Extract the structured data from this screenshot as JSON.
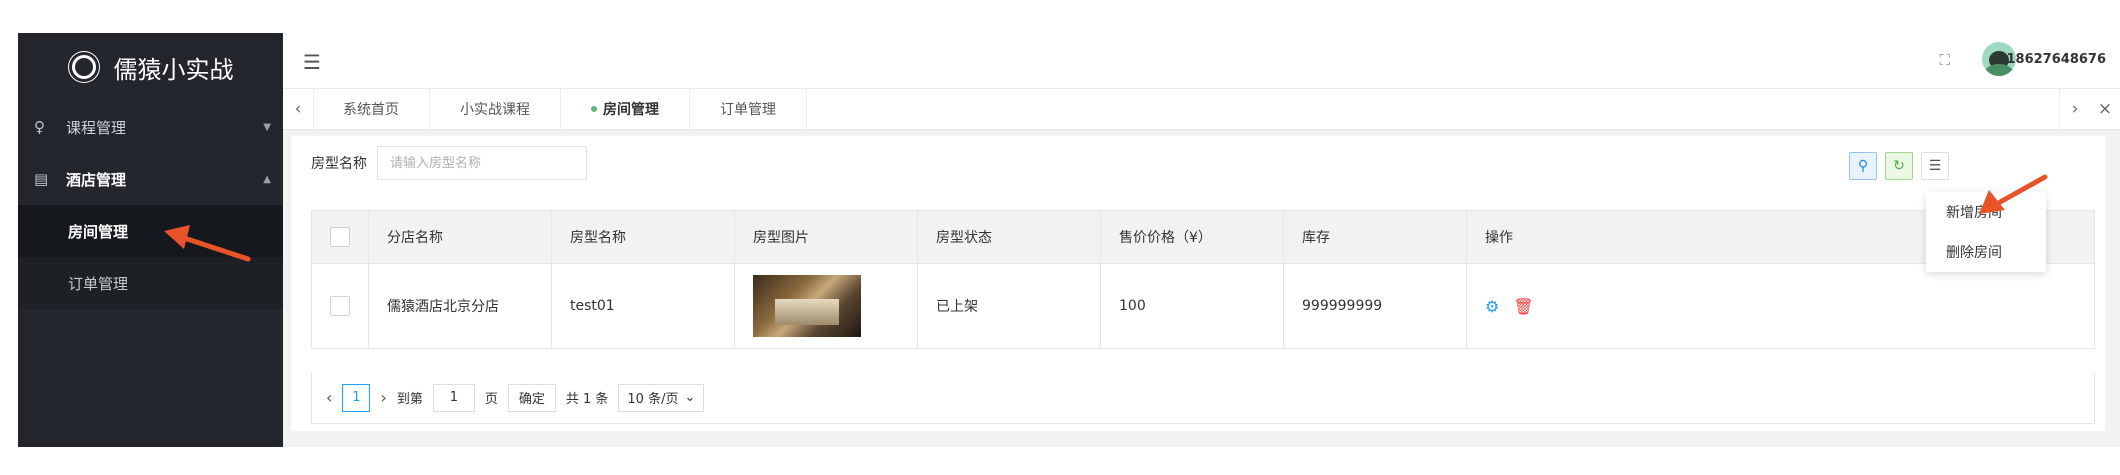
{
  "app": {
    "title": "儒猿小实战"
  },
  "sidebar": {
    "groups": [
      {
        "label": "课程管理",
        "icon": "user-icon",
        "open": false
      },
      {
        "label": "酒店管理",
        "icon": "building-icon",
        "open": true
      }
    ],
    "subitems": [
      {
        "label": "房间管理",
        "active": true
      },
      {
        "label": "订单管理",
        "active": false
      }
    ]
  },
  "header": {
    "username": "18627648676"
  },
  "tabs": [
    {
      "label": "系统首页"
    },
    {
      "label": "小实战课程"
    },
    {
      "label": "房间管理",
      "active": true
    },
    {
      "label": "订单管理"
    }
  ],
  "filter": {
    "label": "房型名称",
    "placeholder": "请输入房型名称"
  },
  "toolbar_dropdown": [
    "新增房间",
    "删除房间"
  ],
  "table": {
    "columns": [
      "分店名称",
      "房型名称",
      "房型图片",
      "房型状态",
      "售价价格（¥）",
      "库存",
      "操作"
    ],
    "rows": [
      {
        "branch": "儒猿酒店北京分店",
        "room_type": "test01",
        "status": "已上架",
        "price": "100",
        "stock": "999999999"
      }
    ]
  },
  "pager": {
    "current": "1",
    "goto_prefix": "到第",
    "goto_value": "1",
    "goto_suffix": "页",
    "confirm": "确定",
    "total": "共 1 条",
    "page_size": "10 条/页"
  },
  "colors": {
    "accent": "#1e9fff",
    "sidebar_bg": "#23272d",
    "annotation_arrow": "#e8532a"
  }
}
